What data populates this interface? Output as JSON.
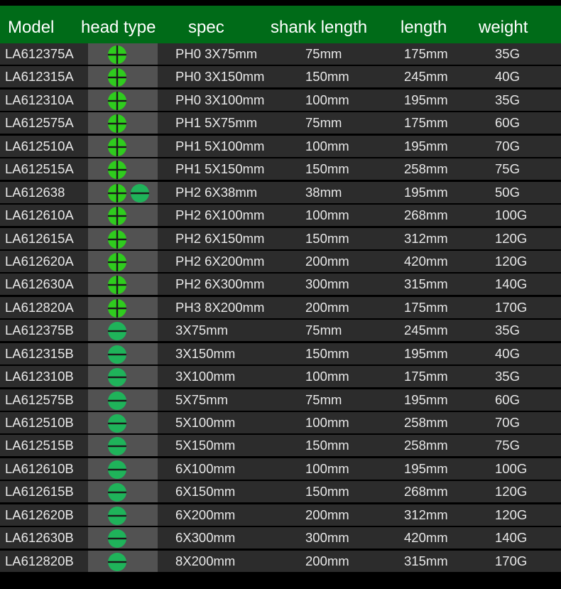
{
  "header": {
    "model": "Model",
    "head_type": "head type",
    "spec": "spec",
    "shank": "shank length",
    "length": "length",
    "weight": "weight"
  },
  "colors": {
    "header_bg": "#006b18",
    "row_bg": "#2c2c2c",
    "head_cell_bg": "#525252",
    "phillips_icon": "#2fcc1e",
    "slotted_icon": "#1fb35a"
  },
  "rows": [
    {
      "model": "LA612375A",
      "heads": [
        "phillips"
      ],
      "spec": "PH0 3X75mm",
      "shank": "75mm",
      "length": "175mm",
      "weight": "35G"
    },
    {
      "model": "LA612315A",
      "heads": [
        "phillips"
      ],
      "spec": "PH0 3X150mm",
      "shank": "150mm",
      "length": "245mm",
      "weight": "40G"
    },
    {
      "model": "LA612310A",
      "heads": [
        "phillips"
      ],
      "spec": "PH0 3X100mm",
      "shank": "100mm",
      "length": "195mm",
      "weight": "35G"
    },
    {
      "model": "LA612575A",
      "heads": [
        "phillips"
      ],
      "spec": "PH1 5X75mm",
      "shank": "75mm",
      "length": "175mm",
      "weight": "60G"
    },
    {
      "model": "LA612510A",
      "heads": [
        "phillips"
      ],
      "spec": "PH1 5X100mm",
      "shank": "100mm",
      "length": "195mm",
      "weight": "70G"
    },
    {
      "model": "LA612515A",
      "heads": [
        "phillips"
      ],
      "spec": "PH1 5X150mm",
      "shank": "150mm",
      "length": "258mm",
      "weight": "75G"
    },
    {
      "model": "LA612638",
      "heads": [
        "phillips",
        "slotted"
      ],
      "spec": "PH2 6X38mm",
      "shank": "38mm",
      "length": "195mm",
      "weight": "50G"
    },
    {
      "model": "LA612610A",
      "heads": [
        "phillips"
      ],
      "spec": "PH2 6X100mm",
      "shank": "100mm",
      "length": "268mm",
      "weight": "100G"
    },
    {
      "model": "LA612615A",
      "heads": [
        "phillips"
      ],
      "spec": "PH2 6X150mm",
      "shank": "150mm",
      "length": "312mm",
      "weight": "120G"
    },
    {
      "model": "LA612620A",
      "heads": [
        "phillips"
      ],
      "spec": "PH2 6X200mm",
      "shank": "200mm",
      "length": "420mm",
      "weight": "120G"
    },
    {
      "model": "LA612630A",
      "heads": [
        "phillips"
      ],
      "spec": "PH2 6X300mm",
      "shank": "300mm",
      "length": "315mm",
      "weight": "140G"
    },
    {
      "model": "LA612820A",
      "heads": [
        "phillips"
      ],
      "spec": "PH3 8X200mm",
      "shank": "200mm",
      "length": "175mm",
      "weight": "170G"
    },
    {
      "model": "LA612375B",
      "heads": [
        "slotted"
      ],
      "spec": "3X75mm",
      "shank": "75mm",
      "length": "245mm",
      "weight": "35G"
    },
    {
      "model": "LA612315B",
      "heads": [
        "slotted"
      ],
      "spec": "3X150mm",
      "shank": "150mm",
      "length": "195mm",
      "weight": "40G"
    },
    {
      "model": "LA612310B",
      "heads": [
        "slotted"
      ],
      "spec": "3X100mm",
      "shank": "100mm",
      "length": "175mm",
      "weight": "35G"
    },
    {
      "model": "LA612575B",
      "heads": [
        "slotted"
      ],
      "spec": "5X75mm",
      "shank": "75mm",
      "length": "195mm",
      "weight": "60G"
    },
    {
      "model": "LA612510B",
      "heads": [
        "slotted"
      ],
      "spec": "5X100mm",
      "shank": "100mm",
      "length": "258mm",
      "weight": "70G"
    },
    {
      "model": "LA612515B",
      "heads": [
        "slotted"
      ],
      "spec": "5X150mm",
      "shank": "150mm",
      "length": "258mm",
      "weight": "75G"
    },
    {
      "model": "LA612610B",
      "heads": [
        "slotted"
      ],
      "spec": "6X100mm",
      "shank": "100mm",
      "length": "195mm",
      "weight": "100G"
    },
    {
      "model": "LA612615B",
      "heads": [
        "slotted"
      ],
      "spec": "6X150mm",
      "shank": "150mm",
      "length": "268mm",
      "weight": "120G"
    },
    {
      "model": "LA612620B",
      "heads": [
        "slotted"
      ],
      "spec": "6X200mm",
      "shank": "200mm",
      "length": "312mm",
      "weight": "120G"
    },
    {
      "model": "LA612630B",
      "heads": [
        "slotted"
      ],
      "spec": "6X300mm",
      "shank": "300mm",
      "length": "420mm",
      "weight": "140G"
    },
    {
      "model": "LA612820B",
      "heads": [
        "slotted"
      ],
      "spec": "8X200mm",
      "shank": "200mm",
      "length": "315mm",
      "weight": "170G"
    }
  ]
}
